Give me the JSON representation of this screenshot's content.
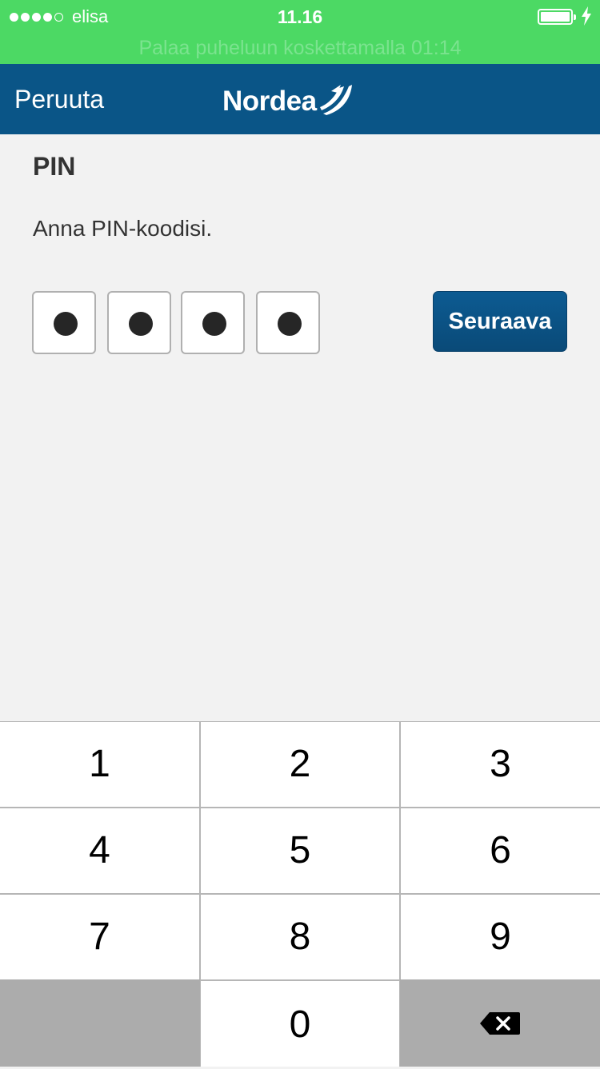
{
  "status_bar": {
    "carrier": "elisa",
    "signal_bars_filled": 4,
    "signal_bars_total": 5,
    "time": "11.16",
    "battery_icon": "battery-icon",
    "charging_icon": "charging-bolt-icon",
    "call_banner": "Palaa puheluun koskettamalla  01:14"
  },
  "nav": {
    "cancel_label": "Peruuta",
    "logo_text": "Nordea",
    "logo_icon": "nordea-sail-icon"
  },
  "content": {
    "title": "PIN",
    "instruction": "Anna PIN-koodisi.",
    "pin_digits_entered": 4,
    "next_label": "Seuraava"
  },
  "keypad": {
    "keys": [
      "1",
      "2",
      "3",
      "4",
      "5",
      "6",
      "7",
      "8",
      "9",
      "",
      "0",
      "backspace"
    ],
    "backspace_icon": "backspace-icon"
  },
  "colors": {
    "status_green": "#4cd964",
    "nav_blue": "#0a5587",
    "button_blue": "#0c5b92",
    "background": "#f2f2f2"
  }
}
